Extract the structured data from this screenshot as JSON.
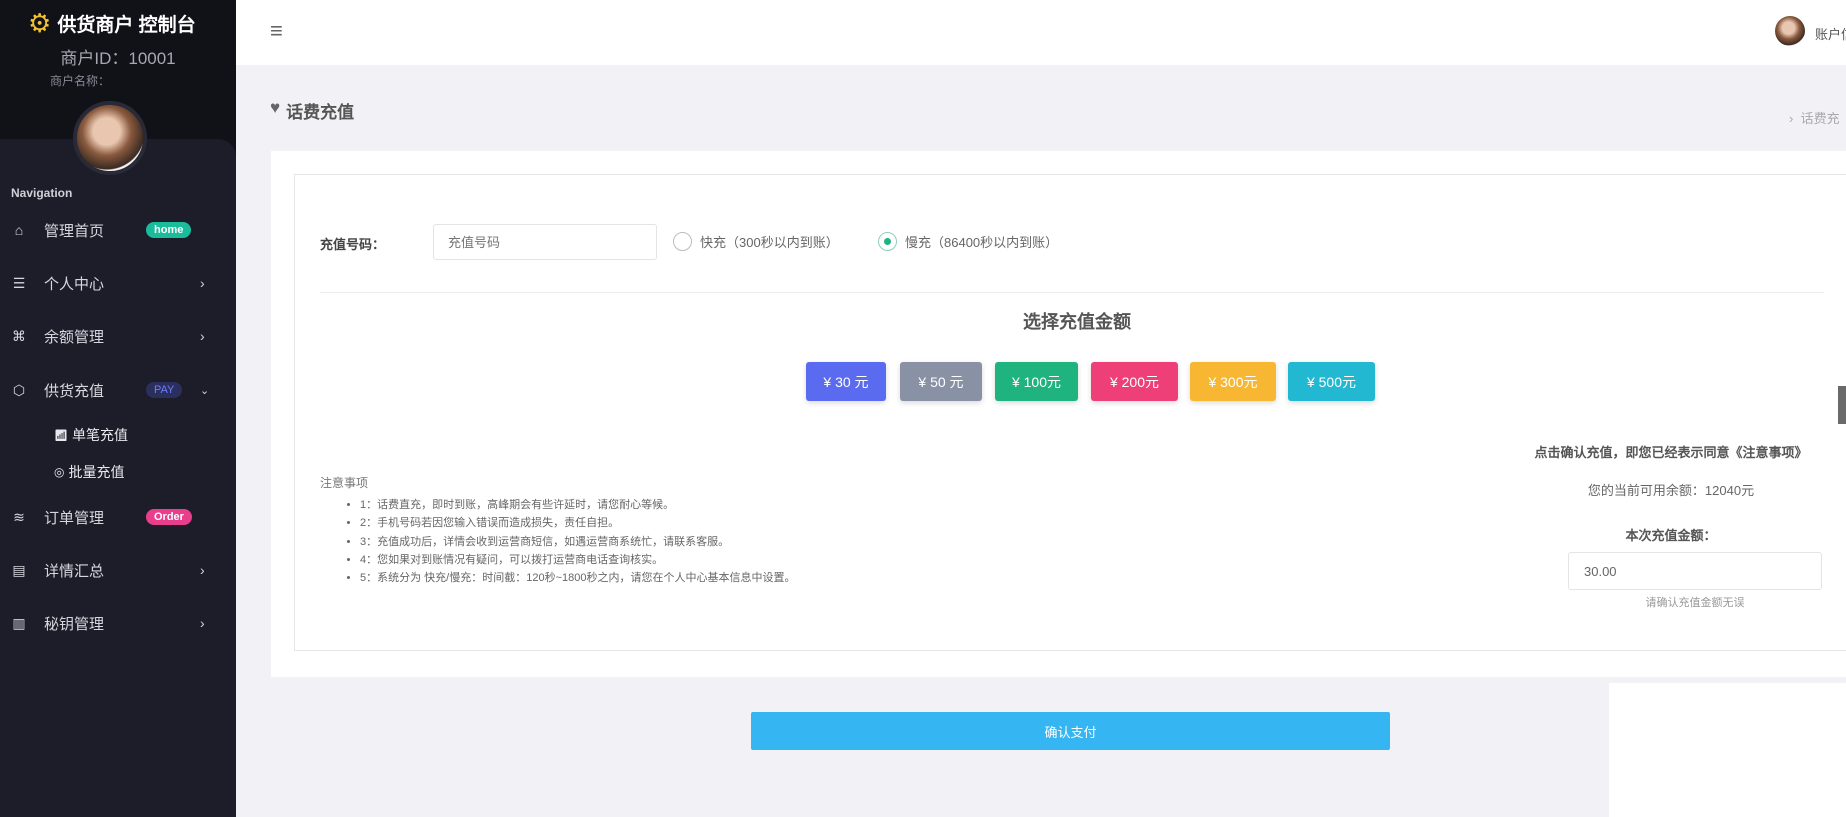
{
  "sidebar": {
    "title": "供货商户 控制台",
    "merchant_id": "商户ID：10001",
    "merchant_name": "商户名称：",
    "nav_heading": "Navigation",
    "items": [
      {
        "label": "管理首页",
        "badge": "home",
        "badge_color": "#1abc9c"
      },
      {
        "label": "个人中心"
      },
      {
        "label": "余额管理"
      },
      {
        "label": "供货充值",
        "badge": "PAY",
        "badge_color": "#2b2f5e"
      },
      {
        "label": "订单管理",
        "badge": "Order",
        "badge_color": "#e83e8c"
      },
      {
        "label": "详情汇总"
      },
      {
        "label": "秘钥管理"
      }
    ],
    "sub_items": [
      {
        "label": "单笔充值"
      },
      {
        "label": "批量充值"
      }
    ]
  },
  "header": {
    "account": "账户信"
  },
  "page": {
    "title": "话费充值",
    "breadcrumb": "话费充"
  },
  "form": {
    "phone_label": "充值号码：",
    "phone_placeholder": "充值号码",
    "phone_value": "",
    "radio_fast": "快充（300秒以内到账）",
    "radio_slow": "慢充（86400秒以内到账）",
    "selected": "slow"
  },
  "amounts": {
    "heading": "选择充值金额",
    "buttons": [
      {
        "label": "¥ 30 元",
        "color": "#5b6bf0"
      },
      {
        "label": "¥ 50 元",
        "color": "#8892a4"
      },
      {
        "label": "¥ 100元",
        "color": "#1fb37f"
      },
      {
        "label": "¥ 200元",
        "color": "#ef3f79"
      },
      {
        "label": "¥ 300元",
        "color": "#f8b733"
      },
      {
        "label": "¥ 500元",
        "color": "#22b8d2"
      }
    ]
  },
  "notes": {
    "title": "注意事项",
    "items": [
      "1：话费直充，即时到账，高峰期会有些许延时，请您耐心等候。",
      "2：手机号码若因您输入错误而造成损失，责任自担。",
      "3：充值成功后，详情会收到运营商短信，如遇运营商系统忙，请联系客服。",
      "4：您如果对到账情况有疑问，可以拨打运营商电话查询核实。",
      "5：系统分为 快充/慢充：时间截：120秒~1800秒之内，请您在个人中心基本信息中设置。"
    ]
  },
  "summary": {
    "agree": "点击确认充值，即您已经表示同意《注意事项》",
    "balance": "您的当前可用余额：12040元",
    "amount_label": "本次充值金额：",
    "amount_value": "30.00",
    "hint": "请确认充值金额无误"
  },
  "confirm": {
    "label": "确认支付",
    "color": "#35b6f2"
  }
}
